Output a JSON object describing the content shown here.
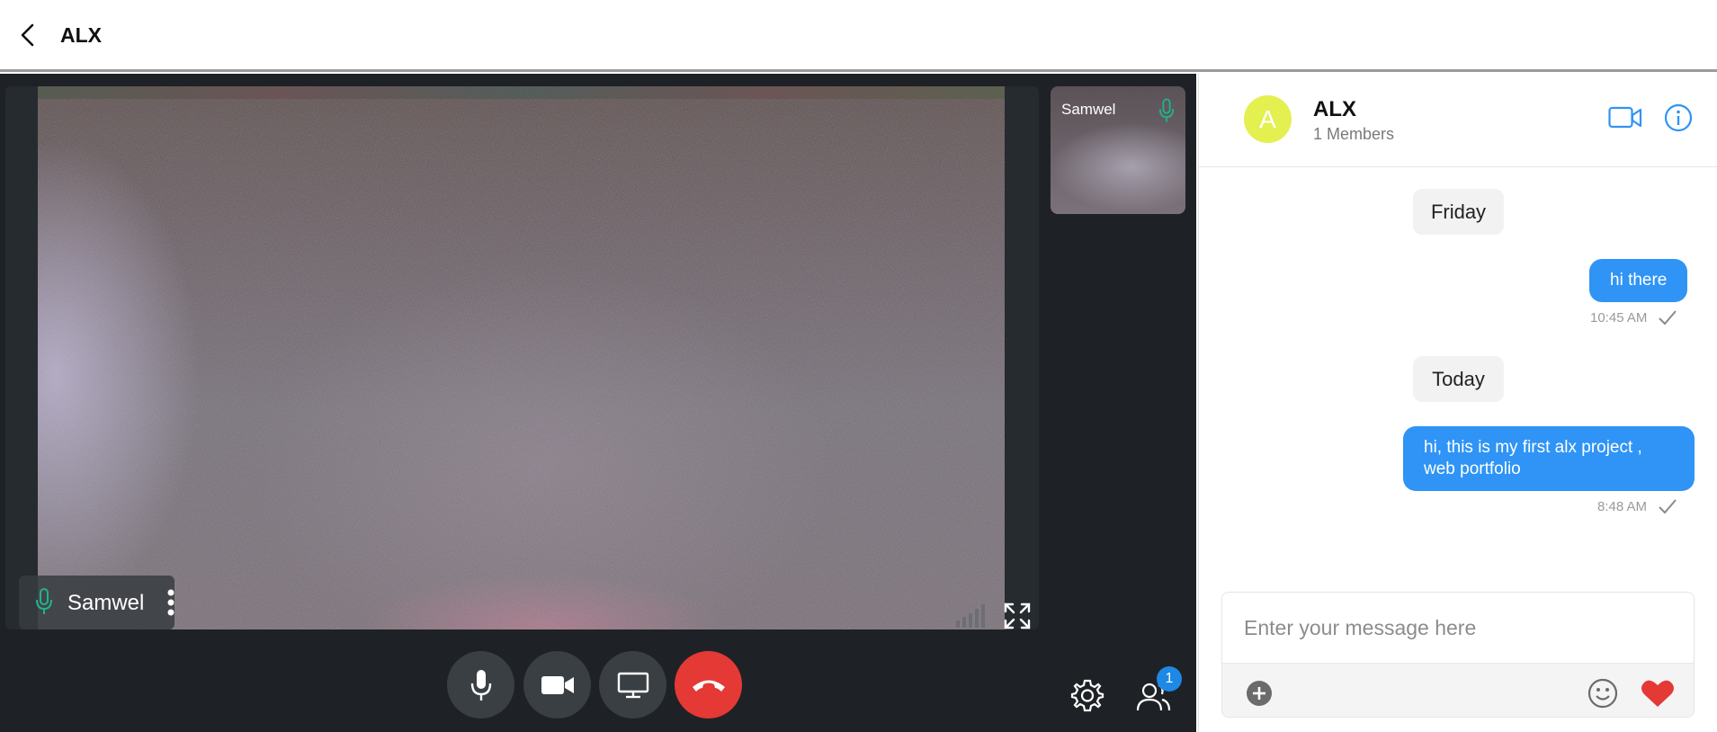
{
  "topbar": {
    "title": "ALX",
    "back_icon": "chevron-left-icon"
  },
  "video": {
    "main_participant": "Samwel",
    "thumbnail_participant": "Samwel",
    "mic_color": "#1db58c",
    "participants_badge": "1",
    "controls": {
      "mic": "microphone-icon",
      "camera": "video-camera-icon",
      "screen": "screen-share-icon",
      "end": "end-call-icon",
      "end_color": "#e53935"
    }
  },
  "chat": {
    "avatar_letter": "A",
    "avatar_color": "#e3f04f",
    "group_name": "ALX",
    "members": "1 Members",
    "accent": "#2f94f5",
    "messages": [
      {
        "day": "Friday",
        "text": "hi there",
        "time": "10:45 AM"
      },
      {
        "day": "Today",
        "text": "hi, this is my first alx project , web portfolio",
        "time": "8:48 AM"
      }
    ],
    "composer": {
      "placeholder": "Enter your message here"
    }
  }
}
